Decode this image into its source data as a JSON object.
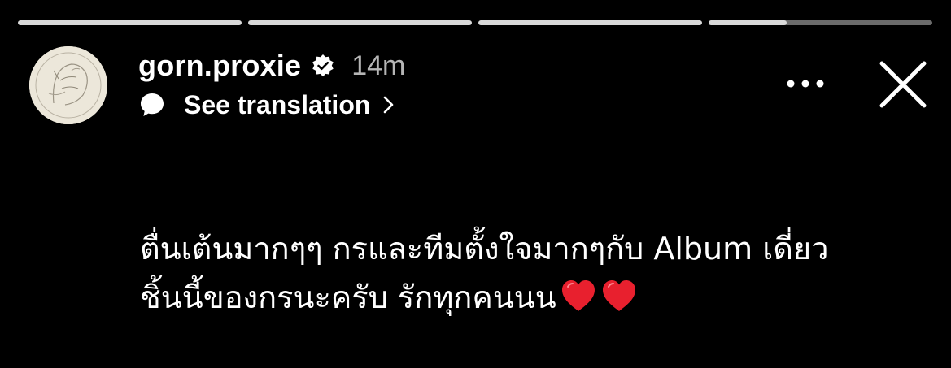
{
  "story": {
    "progress": {
      "segments": [
        1,
        1,
        1,
        0.35
      ]
    },
    "header": {
      "username": "gorn.proxie",
      "verified": true,
      "time": "14m",
      "translate_label": "See translation"
    },
    "icons": {
      "avatar": "avatar-sketch",
      "verified": "verified-badge-icon",
      "translate": "chat-bubble-icon",
      "chevron": "chevron-right-icon",
      "more": "more-options-icon",
      "close": "close-icon",
      "heart": "red-heart-emoji"
    },
    "text": {
      "line1": "ตื่นเต้นมากๆๆ กรและทีมตั้งใจมากๆกับ Album เดี่ยว",
      "line2": "ชิ้นนี้ของกรนะครับ รักทุกคนนน"
    },
    "colors": {
      "background": "#000000",
      "heart": "#e8202e",
      "progress_track": "#6b6b6b",
      "progress_fill": "#d9d9d9"
    }
  }
}
